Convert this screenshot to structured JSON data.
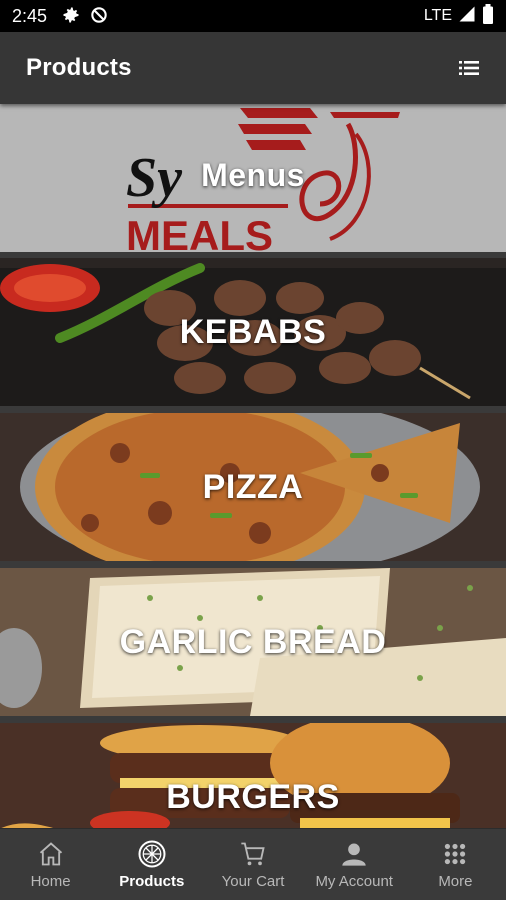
{
  "status_bar": {
    "time": "2:45",
    "network": "LTE",
    "icons": [
      "settings-icon",
      "no-disturb-icon",
      "signal-icon",
      "battery-icon"
    ]
  },
  "app_bar": {
    "title": "Products",
    "menu_icon": "list-icon"
  },
  "tiles": [
    {
      "label": "Menus",
      "logo_text": "Sy",
      "logo_sub": "MEALS"
    },
    {
      "label": "KEBABS"
    },
    {
      "label": "PIZZA"
    },
    {
      "label": "GARLIC BREAD"
    },
    {
      "label": "BURGERS"
    }
  ],
  "bottom_nav": [
    {
      "label": "Home",
      "icon": "home-icon"
    },
    {
      "label": "Products",
      "icon": "pizza-icon",
      "active": true
    },
    {
      "label": "Your Cart",
      "icon": "cart-icon"
    },
    {
      "label": "My Account",
      "icon": "account-icon"
    },
    {
      "label": "More",
      "icon": "grid-icon"
    }
  ],
  "colors": {
    "app_bar": "#363636",
    "brand_red": "#a61c1c",
    "background": "#3a3a3a"
  }
}
